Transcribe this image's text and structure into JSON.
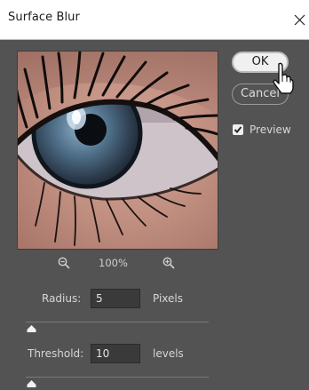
{
  "dialog": {
    "title": "Surface Blur",
    "close_label": "✕"
  },
  "buttons": {
    "ok": "OK",
    "cancel": "Cancel"
  },
  "preview_option": {
    "label": "Preview",
    "checked": true
  },
  "zoom": {
    "level": "100%",
    "zoom_out_icon": "zoom-out-icon",
    "zoom_in_icon": "zoom-in-icon"
  },
  "radius": {
    "label": "Radius:",
    "value": "5",
    "unit": "Pixels",
    "slider_position": 0.03
  },
  "threshold": {
    "label": "Threshold:",
    "value": "10",
    "unit": "levels",
    "slider_position": 0.03
  },
  "colors": {
    "dialog_bg": "#535353",
    "titlebar_bg": "#ffffff",
    "ok_bg": "#f0f0f0",
    "checkbox_check": "#2a2a2a"
  }
}
